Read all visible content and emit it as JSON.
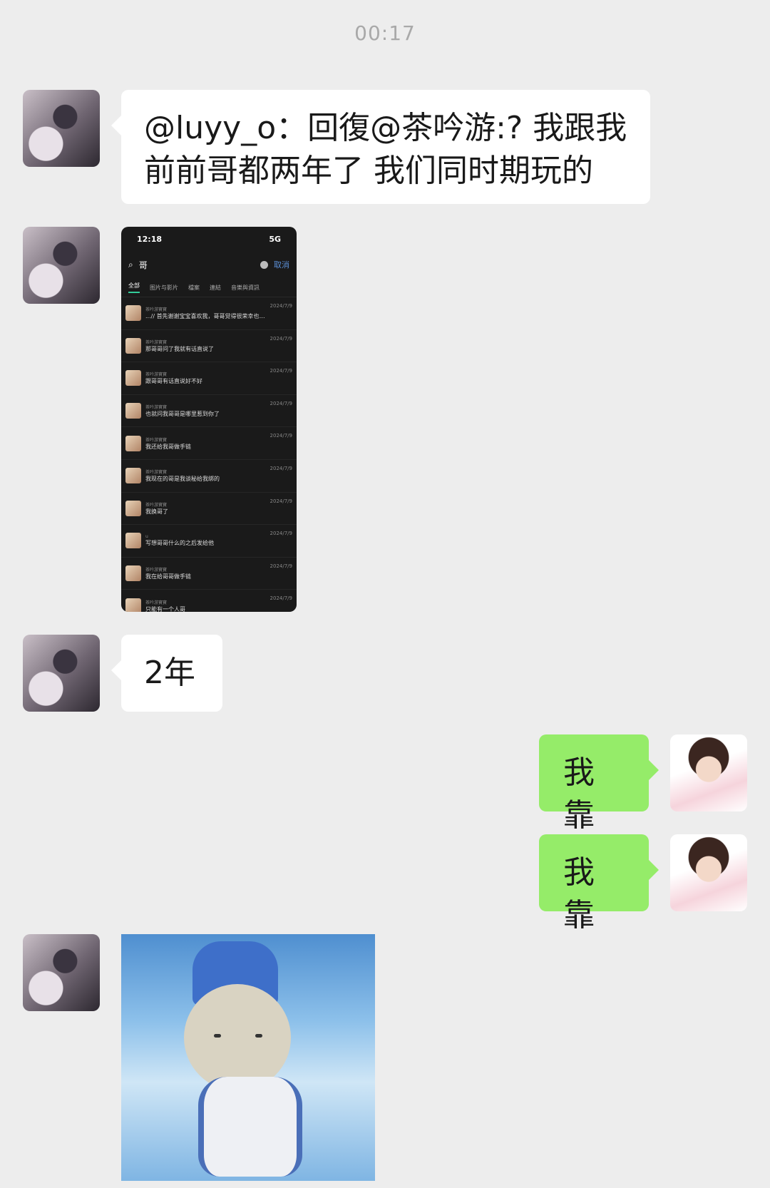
{
  "timestamp": "00:17",
  "messages": {
    "m1": {
      "text_line1": "@luyy_o：回復@茶吟游:? 我跟我",
      "text_line2": "前前哥都两年了 我们同时期玩的"
    },
    "m3": {
      "text": "2年"
    },
    "m4": {
      "text": "我靠"
    },
    "m5": {
      "text": "我靠"
    }
  },
  "screenshot": {
    "time": "12:18",
    "signal": "5G",
    "search_query": "哥",
    "cancel_label": "取消",
    "tabs": [
      "全部",
      "图片与影片",
      "檔案",
      "連結",
      "音樂與資訊"
    ],
    "rows": [
      {
        "name": "茶吟游寶寶",
        "msg": "...// 首先谢谢宝宝喜欢我，哥哥觉得很荣幸也很幸...",
        "date": "2024/7/9"
      },
      {
        "name": "茶吟游寶寶",
        "msg": "那哥哥问了我就有话直说了",
        "date": "2024/7/9"
      },
      {
        "name": "茶吟游寶寶",
        "msg": "跟哥哥有话直说好不好",
        "date": "2024/7/9"
      },
      {
        "name": "茶吟游寶寶",
        "msg": "也就问我哥哥是哪里惹到你了",
        "date": "2024/7/9"
      },
      {
        "name": "茶吟游寶寶",
        "msg": "我还给我哥做手链",
        "date": "2024/7/9"
      },
      {
        "name": "茶吟游寶寶",
        "msg": "我现在的哥是我谈秘给我绑的",
        "date": "2024/7/9"
      },
      {
        "name": "茶吟游寶寶",
        "msg": "我换哥了",
        "date": "2024/7/9"
      },
      {
        "name": "u",
        "msg": "写想哥哥什么的之后发给他",
        "date": "2024/7/9"
      },
      {
        "name": "茶吟游寶寶",
        "msg": "我在给哥哥做手链",
        "date": "2024/7/9"
      },
      {
        "name": "茶吟游寶寶",
        "msg": "只能有一个人哥",
        "date": "2024/7/9"
      }
    ]
  }
}
